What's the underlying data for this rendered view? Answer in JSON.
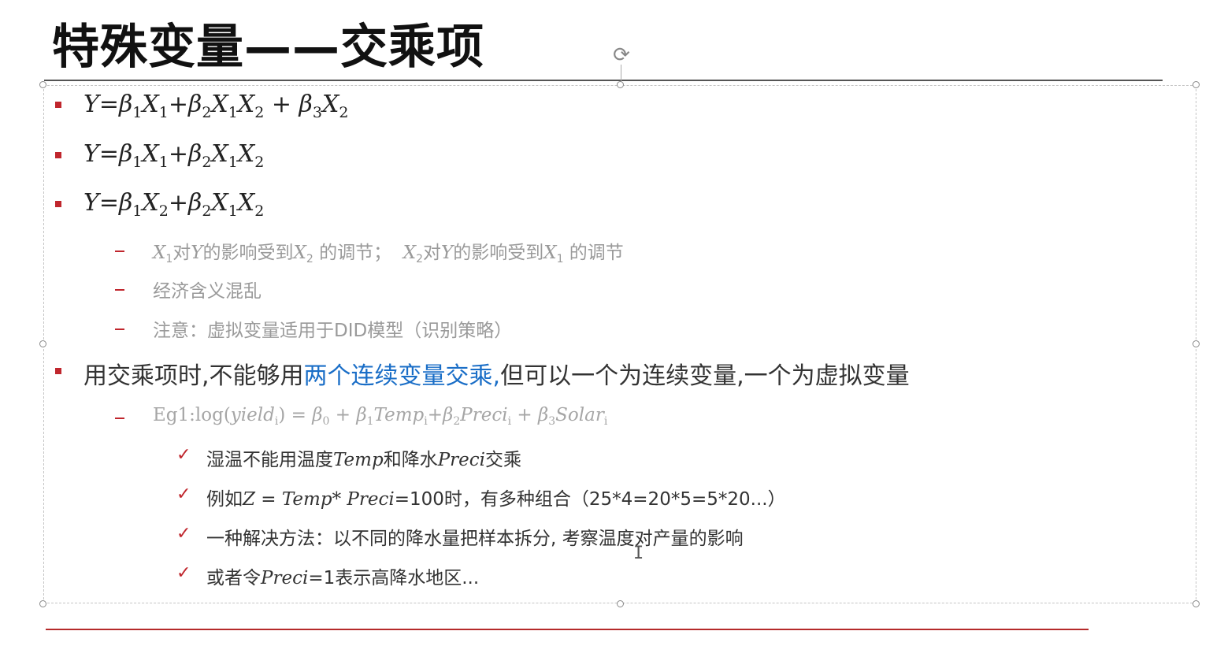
{
  "slide": {
    "title": "特殊变量——交乘项",
    "rotate_icon": "rotate-handle-icon",
    "check_icon": "checkmark-icon",
    "bullet_color": "#c0262d",
    "highlight_color": "#1a6ec7",
    "equations": [
      {
        "Y": "Y",
        "eq": "=",
        "b1": "β",
        "s1": "1",
        "x1": "X",
        "xs1": "1",
        "plus1": "+",
        "b2": "β",
        "s2": "2",
        "x2": "X",
        "xs2": "1",
        "x3": "X",
        "xs3": "2",
        "plus2": " + ",
        "b3": "β",
        "s3": "3",
        "x4": "X",
        "xs4": "2"
      },
      {
        "Y": "Y",
        "eq": "=",
        "b1": "β",
        "s1": "1",
        "x1": "X",
        "xs1": "1",
        "plus1": "+",
        "b2": "β",
        "s2": "2",
        "x2": "X",
        "xs2": "1",
        "x3": "X",
        "xs3": "2"
      },
      {
        "Y": "Y",
        "eq": "=",
        "b1": "β",
        "s1": "1",
        "x1": "X",
        "xs1": "2",
        "plus1": "+",
        "b2": "β",
        "s2": "2",
        "x2": "X",
        "xs2": "1",
        "x3": "X",
        "xs3": "2"
      }
    ],
    "notes": {
      "n1": {
        "a": "X",
        "as": "1",
        "b": "对",
        "c": "Y",
        "d": "的影响受到",
        "e": "X",
        "es": "2",
        "f": " 的调节；  ",
        "g": "X",
        "gs": "2",
        "h": "对",
        "i": "Y",
        "j": "的影响受到",
        "k": "X",
        "ks": "1",
        "l": " 的调节"
      },
      "n2": "经济含义混乱",
      "n3": "注意：虚拟变量适用于DID模型（识别策略）"
    },
    "interaction": {
      "part1": "用交乘项时,不能够用",
      "highlight": "两个连续变量交乘,",
      "part2": "但可以一个为连续变量,一个为虚拟变量"
    },
    "example": {
      "prefix": "Eg1:log(",
      "yield": "yield",
      "yield_sub": "i",
      "mid1": ") = ",
      "b0": "β",
      "b0s": "0",
      "p1": " + ",
      "b1": "β",
      "b1s": "1",
      "temp": "Temp",
      "temps": "i",
      "p2": "+",
      "b2": "β",
      "b2s": "2",
      "preci": "Preci",
      "precis": "i",
      "p3": " + ",
      "b3": "β",
      "b3s": "3",
      "solar": "Solar",
      "solars": "i"
    },
    "checks": {
      "c1": {
        "a": "湿温不能用温度",
        "b": "Temp",
        "c": "和降水",
        "d": "Preci",
        "e": "交乘"
      },
      "c2": {
        "a": "例如",
        "b": "Z = Temp* Preci",
        "c": "=100时，有多种组合（25*4=20*5=5*20...）"
      },
      "c3": "一种解决方法：以不同的降水量把样本拆分, 考察温度对产量的影响",
      "c4": {
        "a": "或者令",
        "b": "Preci",
        "c": "=1表示高降水地区..."
      }
    }
  }
}
